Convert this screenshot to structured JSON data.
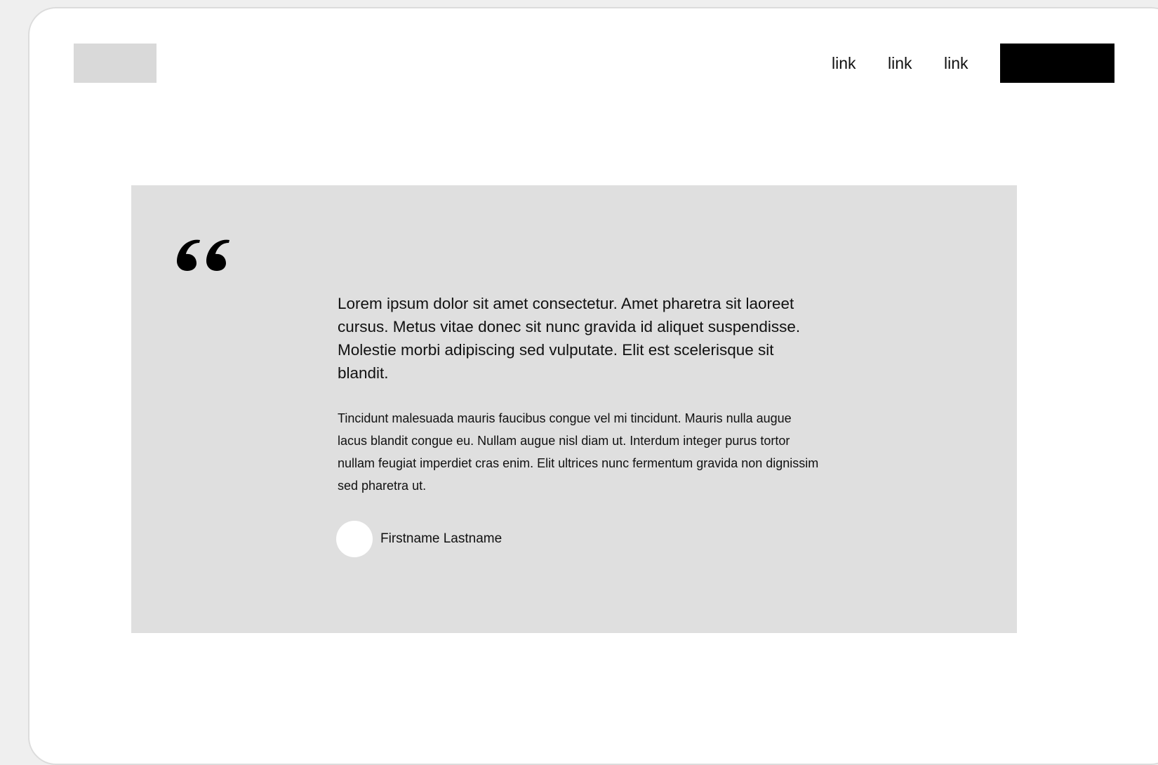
{
  "header": {
    "logo": "logo-placeholder",
    "nav_links": [
      "link",
      "link",
      "link"
    ],
    "cta_label": ""
  },
  "testimonial": {
    "quote_icon": "quote-icon",
    "lead": "Lorem ipsum dolor sit amet consectetur. Amet pharetra sit laoreet cursus. Metus vitae donec sit nunc gravida id aliquet suspendisse. Molestie morbi adipiscing sed vulputate. Elit est scelerisque sit blandit.",
    "body": "Tincidunt malesuada mauris faucibus congue vel mi tincidunt. Mauris nulla augue lacus blandit congue eu. Nullam augue nisl diam ut. Interdum integer purus tortor nullam feugiat imperdiet cras enim. Elit ultrices nunc fermentum gravida non dignissim sed pharetra ut.",
    "author_name": "Firstname Lastname",
    "avatar": "avatar-placeholder"
  },
  "colors": {
    "page_background": "#efefef",
    "frame_background": "#ffffff",
    "logo_placeholder": "#d9d9d9",
    "cta_background": "#000000",
    "testimonial_background": "#dfdfdf",
    "avatar_background": "#ffffff"
  }
}
